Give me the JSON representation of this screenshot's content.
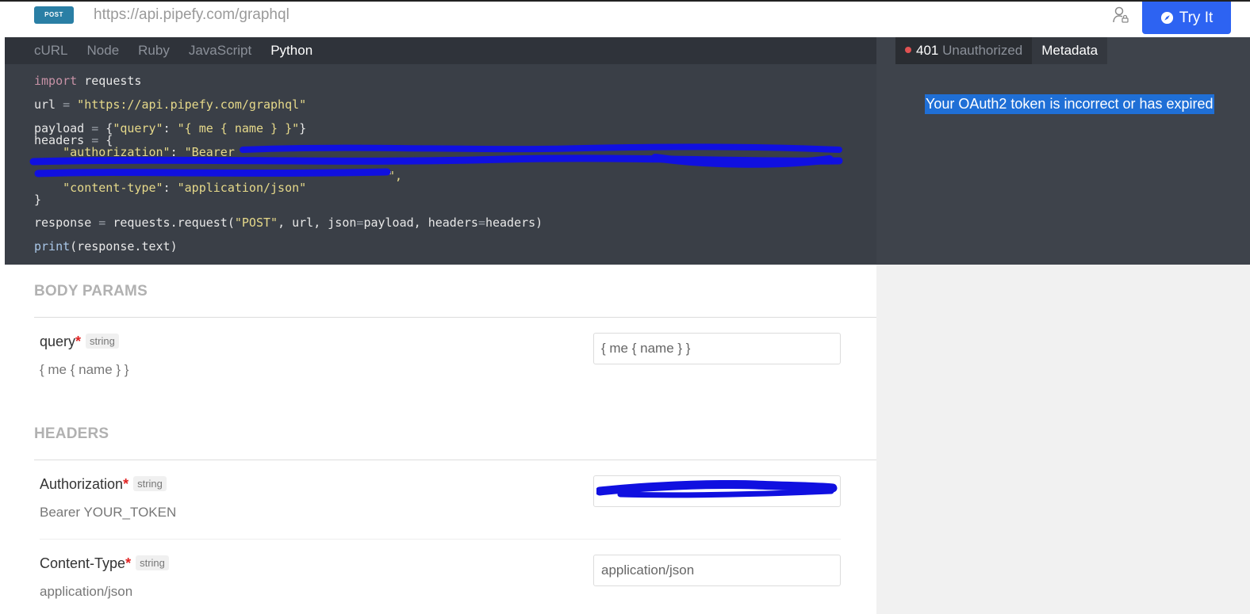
{
  "topbar": {
    "method": "POST",
    "url": "https://api.pipefy.com/graphql",
    "try_label": "Try It"
  },
  "code_panel": {
    "tabs": [
      "cURL",
      "Node",
      "Ruby",
      "JavaScript",
      "Python"
    ],
    "active_tab": "Python",
    "lines": {
      "import_kw": "import",
      "import_mod": " requests",
      "url_var": "url ",
      "url_eq": "=",
      "url_val": " \"https://api.pipefy.com/graphql\"",
      "payload_var": "payload ",
      "payload_eq": "=",
      "payload_open": " {",
      "payload_key": "\"query\"",
      "payload_colon": ": ",
      "payload_val": "\"{ me { name } }\"",
      "payload_close": "}",
      "headers_var": "headers ",
      "headers_eq": "=",
      "headers_open": " {",
      "auth_key": "    \"authorization\"",
      "auth_sep": ": ",
      "auth_val": "\"Bearer",
      "auth_tail": "\",",
      "ct_key": "    \"content-type\"",
      "ct_sep": ": ",
      "ct_val": "\"application/json\"",
      "headers_close": "}",
      "resp_line_a": "response ",
      "resp_eq": "=",
      "resp_line_b": " requests.request(",
      "resp_method": "\"POST\"",
      "resp_line_c": ", url, json",
      "resp_eq2": "=",
      "resp_line_d": "payload, headers",
      "resp_eq3": "=",
      "resp_line_e": "headers)",
      "print_fn": "print",
      "print_args": "(response.text)"
    }
  },
  "response_panel": {
    "status_code": "401",
    "status_text": "Unauthorized",
    "meta_tab": "Metadata",
    "message": "Your OAuth2 token is incorrect or has expired"
  },
  "body_params": {
    "title": "BODY PARAMS",
    "items": [
      {
        "name": "query",
        "required_mark": "*",
        "type": "string",
        "description": "{ me { name } }",
        "value": "{ me { name } }"
      }
    ]
  },
  "headers_section": {
    "title": "HEADERS",
    "items": [
      {
        "name": "Authorization",
        "required_mark": "*",
        "type": "string",
        "description": "Bearer YOUR_TOKEN",
        "value": ""
      },
      {
        "name": "Content-Type",
        "required_mark": "*",
        "type": "string",
        "description": "application/json",
        "value": "application/json"
      }
    ]
  },
  "colors": {
    "accent": "#2d63f2",
    "method_badge": "#2a7fa5",
    "code_bg": "#3a3f47",
    "error_dot": "#e05252",
    "redaction": "#1010e0"
  },
  "icons": [
    "user-lock-icon",
    "compass-icon",
    "status-dot-icon"
  ]
}
